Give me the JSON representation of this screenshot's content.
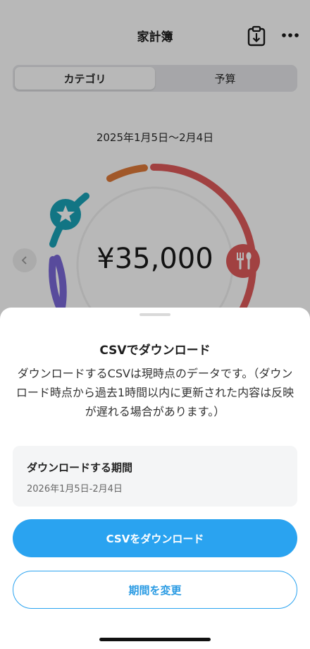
{
  "header": {
    "title": "家計簿",
    "export_icon": "clipboard-download-icon",
    "more_icon": "more-horizontal-icon"
  },
  "tabs": [
    {
      "label": "カテゴリ",
      "active": true
    },
    {
      "label": "予算",
      "active": false
    }
  ],
  "summary": {
    "date_range": "2025年1月5日〜2月4日",
    "total": "¥35,000",
    "prev_icon": "chevron-left-icon"
  },
  "donut": {
    "segments": [
      {
        "category": "food",
        "icon": "fork-spoon-icon",
        "color": "#e05a5a"
      },
      {
        "category": "other",
        "color": "#7b68d8"
      },
      {
        "category": "favorite",
        "icon": "star-icon",
        "color": "#1aa3b8"
      },
      {
        "category": "misc",
        "color": "#e07b3a"
      }
    ]
  },
  "sheet": {
    "title": "CSVでダウンロード",
    "description": "ダウンロードするCSVは現時点のデータです。（ダウンロード時点から過去1時間以内に更新された内容は反映が遅れる場合があります。）",
    "period_label": "ダウンロードする期間",
    "period_value": "2026年1月5日-2月4日",
    "download_label": "CSVをダウンロード",
    "change_label": "期間を変更"
  },
  "colors": {
    "accent": "#2aa3f0",
    "card_bg": "#f4f5f6"
  }
}
